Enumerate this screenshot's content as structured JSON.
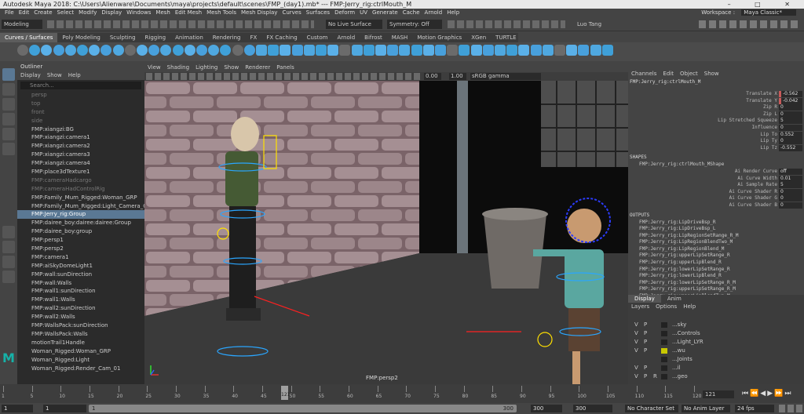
{
  "title_bar": {
    "title": "Autodesk Maya 2018: C:\\Users\\Alienware\\Documents\\maya\\projects\\default\\scenes\\FMP_(day1).mb*  ---  FMP:Jerry_rig:ctrlMouth_M"
  },
  "menu_bar": {
    "items": [
      "File",
      "Edit",
      "Create",
      "Select",
      "Modify",
      "Display",
      "Windows",
      "Mesh",
      "Edit Mesh",
      "Mesh Tools",
      "Mesh Display",
      "Curves",
      "Surfaces",
      "Deform",
      "UV",
      "Generate",
      "Cache",
      "Arnold",
      "Help"
    ],
    "workspace_label": "Workspace :",
    "workspace_value": "Maya Classic*"
  },
  "status_line": {
    "mode": "Modeling",
    "live_surface": "No Live Surface",
    "symmetry": "Symmetry: Off",
    "user": "Luo Tang"
  },
  "shelf": {
    "tabs": [
      "Curves / Surfaces",
      "Poly Modeling",
      "Sculpting",
      "Rigging",
      "Animation",
      "Rendering",
      "FX",
      "FX Caching",
      "Custom",
      "Arnold",
      "Bifrost",
      "MASH",
      "Motion Graphics",
      "XGen",
      "TURTLE"
    ],
    "active_tab": "Curves / Surfaces"
  },
  "outliner": {
    "title": "Outliner",
    "menu": [
      "Display",
      "Show",
      "Help"
    ],
    "search_placeholder": "Search...",
    "items": [
      {
        "label": "persp",
        "dim": true
      },
      {
        "label": "top",
        "dim": true
      },
      {
        "label": "front",
        "dim": true
      },
      {
        "label": "side",
        "dim": true
      },
      {
        "label": "FMP:xiangzi:BG",
        "dim": false
      },
      {
        "label": "FMP:xiangzi:camera1",
        "dim": false
      },
      {
        "label": "FMP:xiangzi:camera2",
        "dim": false
      },
      {
        "label": "FMP:xiangzi:camera3",
        "dim": false
      },
      {
        "label": "FMP:xiangzi:camera4",
        "dim": false
      },
      {
        "label": "FMP:place3dTexture1",
        "dim": false
      },
      {
        "label": "FMP:cameraHadcargo",
        "dim": true
      },
      {
        "label": "FMP:cameraHadControlRig",
        "dim": true
      },
      {
        "label": "FMP:Family_Mum_Rigged:Woman_GRP",
        "dim": false
      },
      {
        "label": "FMP:Family_Mum_Rigged:Light_Camera_GR",
        "dim": false
      },
      {
        "label": "FMP:Jerry_rig:Group",
        "dim": false,
        "selected": true
      },
      {
        "label": "FMP:dairee_boy:dairee:dairee:Group",
        "dim": false
      },
      {
        "label": "FMP:dairee_boy:group",
        "dim": false
      },
      {
        "label": "FMP:persp1",
        "dim": false
      },
      {
        "label": "FMP:persp2",
        "dim": false
      },
      {
        "label": "FMP:camera1",
        "dim": false
      },
      {
        "label": "FMP:aiSkyDomeLight1",
        "dim": false
      },
      {
        "label": "FMP:wall:sunDirection",
        "dim": false
      },
      {
        "label": "FMP:wall:Walls",
        "dim": false
      },
      {
        "label": "FMP:wall1:sunDirection",
        "dim": false
      },
      {
        "label": "FMP:wall1:Walls",
        "dim": false
      },
      {
        "label": "FMP:wall2:sunDirection",
        "dim": false
      },
      {
        "label": "FMP:wall2:Walls",
        "dim": false
      },
      {
        "label": "FMP:WallsPack:sunDirection",
        "dim": false
      },
      {
        "label": "FMP:WallsPack:Walls",
        "dim": false
      },
      {
        "label": "motionTrail1Handle",
        "dim": false
      },
      {
        "label": "Woman_Rigged:Woman_GRP",
        "dim": false
      },
      {
        "label": "Woman_Rigged:Light",
        "dim": false
      },
      {
        "label": "Woman_Rigged:Render_Cam_01",
        "dim": false
      }
    ]
  },
  "viewport": {
    "menu": [
      "View",
      "Shading",
      "Lighting",
      "Show",
      "Renderer",
      "Panels"
    ],
    "field_a": "0.00",
    "field_b": "1.00",
    "color_space": "sRGB gamma",
    "camera_label": "FMP:persp2"
  },
  "channel_box": {
    "menu": [
      "Channels",
      "Edit",
      "Object",
      "Show"
    ],
    "node": "FMP:Jerry_rig:ctrlMouth_M",
    "channels": [
      {
        "name": "Translate X",
        "value": "-0.562",
        "keyed": true
      },
      {
        "name": "Translate Y",
        "value": "-0.042",
        "keyed": true
      },
      {
        "name": "Zip R",
        "value": "0"
      },
      {
        "name": "Zip L",
        "value": "0"
      },
      {
        "name": "Lip Stretched Squeeze",
        "value": "5"
      },
      {
        "name": "Influence",
        "value": "0"
      },
      {
        "name": "Lip To",
        "value": "0.552"
      },
      {
        "name": "Lip Ty",
        "value": "0"
      },
      {
        "name": "Lip Tz",
        "value": "-0.552"
      }
    ],
    "shapes_header": "SHAPES",
    "shape_node": "FMP:Jerry_rig:ctrlMouth_MShape",
    "shape_attrs": [
      {
        "name": "Ai Render Curve",
        "value": "off"
      },
      {
        "name": "Ai Curve Width",
        "value": "0.01"
      },
      {
        "name": "Ai Sample Rate",
        "value": "5"
      },
      {
        "name": "Ai Curve Shader R",
        "value": "0"
      },
      {
        "name": "Ai Curve Shader G",
        "value": "0"
      },
      {
        "name": "Ai Curve Shader B",
        "value": "0"
      }
    ],
    "outputs_header": "OUTPUTS",
    "outputs": [
      "FMP:Jerry_rig:LipDriveBsp_R",
      "FMP:Jerry_rig:LipDriveBsp_L",
      "FMP:Jerry_rig:LipRegionSetRange_R_M",
      "FMP:Jerry_rig:LipRegionBlendTwo_M",
      "FMP:Jerry_rig:LipRegionBlend_M",
      "FMP:Jerry_rig:upperLipSetRange_R",
      "FMP:Jerry_rig:upperLipBlend_R",
      "FMP:Jerry_rig:lowerLipSetRange_R",
      "FMP:Jerry_rig:lowerLipBlend_R",
      "FMP:Jerry_rig:lowerLipSetRange_R_M",
      "FMP:Jerry_rig:upperLipSetRange_R_M",
      "FMP:Jerry_rig:upperLipBlendTwo_M"
    ]
  },
  "layer_editor": {
    "tabs": [
      "Display",
      "Anim"
    ],
    "menu": [
      "Layers",
      "Options",
      "Help"
    ],
    "layers": [
      {
        "v": "V",
        "p": "P",
        "r": "",
        "name": "...sky"
      },
      {
        "v": "V",
        "p": "P",
        "r": "",
        "name": "...Controls"
      },
      {
        "v": "V",
        "p": "P",
        "r": "",
        "name": "...Light_LYR"
      },
      {
        "v": "V",
        "p": "P",
        "r": "",
        "name": "...wu"
      },
      {
        "v": "",
        "p": "",
        "r": "",
        "name": "...Joints"
      },
      {
        "v": "V",
        "p": "P",
        "r": "",
        "name": "...il"
      },
      {
        "v": "V",
        "p": "P",
        "r": "R",
        "name": "...geo"
      }
    ]
  },
  "timeline": {
    "ticks": [
      "1",
      "5",
      "10",
      "15",
      "20",
      "25",
      "30",
      "35",
      "40",
      "45",
      "50",
      "55",
      "60",
      "65",
      "70",
      "75",
      "80",
      "85",
      "90",
      "95",
      "100",
      "105",
      "110",
      "115",
      "120"
    ],
    "current_frame": "121",
    "frame_field": "121"
  },
  "range_bar": {
    "start": "1",
    "start2": "1",
    "range_label": "1",
    "end": "300",
    "end2": "300",
    "end3": "300",
    "character_set": "No Character Set",
    "anim_layer": "No Anim Layer",
    "fps": "24 fps"
  },
  "colors": {
    "selection": "#5a7894",
    "keyed": "#c85a5a",
    "panel": "#444444"
  }
}
